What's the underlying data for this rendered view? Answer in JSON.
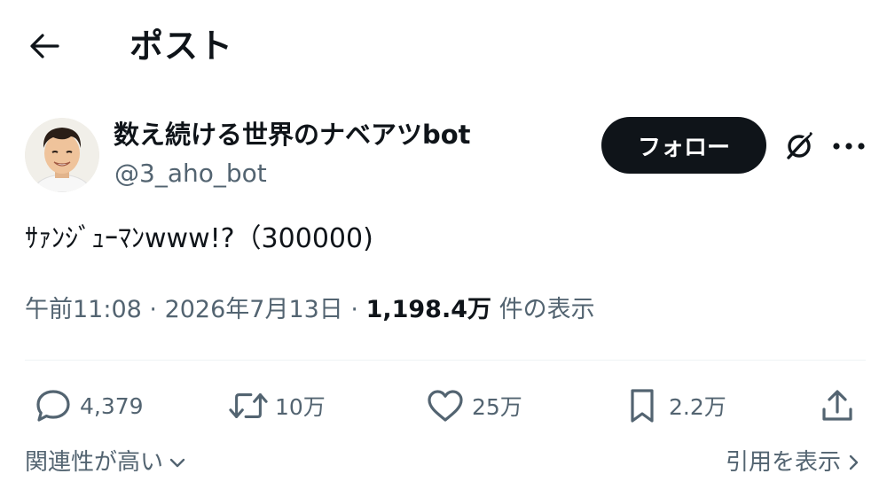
{
  "header": {
    "back_icon": "arrow-left-icon",
    "title": "ポスト"
  },
  "author": {
    "display_name": "数え続ける世界のナベアツbot",
    "handle": "@3_aho_bot",
    "avatar_icon": "profile-photo"
  },
  "follow_button": {
    "label": "フォロー"
  },
  "icons": {
    "grok": "grok-icon",
    "more": "more-horizontal-icon"
  },
  "tweet": {
    "text": "ｻｧﾝｼﾞｭｰﾏﾝwww!?（300000)"
  },
  "meta": {
    "time": "午前11:08",
    "separator_1": " · ",
    "date": "2026年7月13日",
    "separator_2": " · ",
    "views_count": "1,198.4万",
    "views_label": " 件の表示"
  },
  "actions": {
    "reply": {
      "icon": "reply-bubble-icon",
      "count": "4,379"
    },
    "retweet": {
      "icon": "retweet-icon",
      "count": "10万"
    },
    "like": {
      "icon": "heart-icon",
      "count": "25万"
    },
    "bookmark": {
      "icon": "bookmark-icon",
      "count": "2.2万"
    },
    "share": {
      "icon": "share-icon"
    }
  },
  "footer": {
    "sort_label": "関連性が高い",
    "quotes_label": "引用を表示"
  },
  "colors": {
    "text_primary": "#0f1419",
    "text_secondary": "#536471",
    "follow_bg": "#0f1419",
    "divider": "#eff3f4"
  }
}
